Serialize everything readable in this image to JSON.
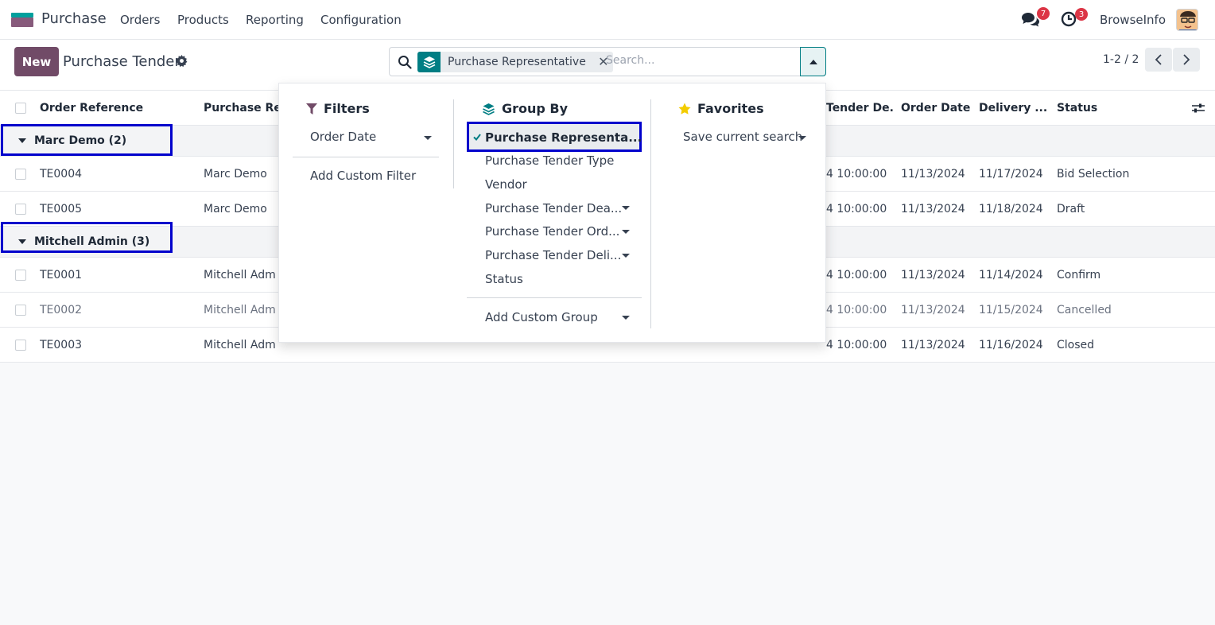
{
  "navbar": {
    "app_name": "Purchase",
    "menu": [
      "Orders",
      "Products",
      "Reporting",
      "Configuration"
    ],
    "messages_count": "7",
    "activities_count": "3",
    "company": "BrowseInfo"
  },
  "control": {
    "new_label": "New",
    "title": "Purchase Tender",
    "facet_label": "Purchase Representative",
    "facet_remove": "✕",
    "search_placeholder": "Search...",
    "pager": "1-2 / 2"
  },
  "list": {
    "columns": [
      "Order Reference",
      "Purchase Rep",
      "Tender De...",
      "Order Date",
      "Delivery ...",
      "Status"
    ],
    "groups": [
      {
        "label": "Marc Demo (2)",
        "rows": [
          {
            "ref": "TE0004",
            "rep": "Marc Demo",
            "deadline": "4 10:00:00",
            "order_date": "11/13/2024",
            "delivery": "11/17/2024",
            "status": "Bid Selection"
          },
          {
            "ref": "TE0005",
            "rep": "Marc Demo",
            "deadline": "4 10:00:00",
            "order_date": "11/13/2024",
            "delivery": "11/18/2024",
            "status": "Draft"
          }
        ]
      },
      {
        "label": "Mitchell Admin (3)",
        "rows": [
          {
            "ref": "TE0001",
            "rep": "Mitchell Adm",
            "deadline": "4 10:00:00",
            "order_date": "11/13/2024",
            "delivery": "11/14/2024",
            "status": "Confirm"
          },
          {
            "ref": "TE0002",
            "rep": "Mitchell Adm",
            "deadline": "4 10:00:00",
            "order_date": "11/13/2024",
            "delivery": "11/15/2024",
            "status": "Cancelled"
          },
          {
            "ref": "TE0003",
            "rep": "Mitchell Adm",
            "deadline": "4 10:00:00",
            "order_date": "11/13/2024",
            "delivery": "11/16/2024",
            "status": "Closed"
          }
        ]
      }
    ]
  },
  "dropdown": {
    "filters": {
      "title": "Filters",
      "items": [
        "Order Date"
      ],
      "add_custom": "Add Custom Filter"
    },
    "group_by": {
      "title": "Group By",
      "items": [
        "Purchase Representa...",
        "Purchase Tender Type",
        "Vendor",
        "Purchase Tender Dea...",
        "Purchase Tender Ord...",
        "Purchase Tender Deli...",
        "Status"
      ],
      "add_custom": "Add Custom Group"
    },
    "favorites": {
      "title": "Favorites",
      "save": "Save current search"
    }
  },
  "colors": {
    "brand": "#714b67",
    "accent": "#017e84",
    "highlight": "#0000cc"
  }
}
